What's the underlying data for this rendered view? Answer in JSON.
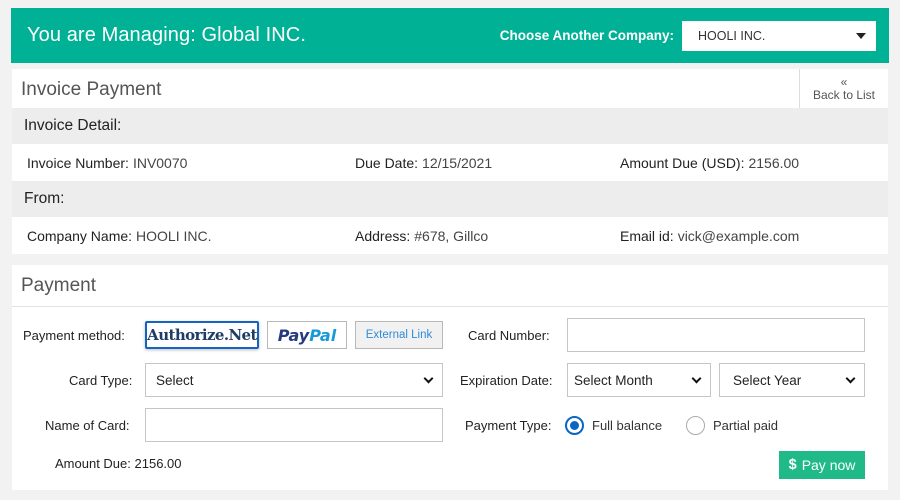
{
  "header": {
    "title": "You are Managing: Global INC.",
    "choose_label": "Choose Another Company:",
    "company_selected": "HOOLI INC."
  },
  "invoice": {
    "title": "Invoice Payment",
    "back_icon": "double-chevron-left-icon",
    "back_icon_glyph": "«",
    "back_label": "Back to List",
    "detail_heading": "Invoice Detail:",
    "invoice_number_label": "Invoice Number:",
    "invoice_number": "INV0070",
    "due_date_label": "Due Date:",
    "due_date": "12/15/2021",
    "amount_due_label": "Amount Due (USD):",
    "amount_due": "2156.00",
    "from_heading": "From:",
    "company_name_label": "Company Name:",
    "company_name": "HOOLI INC.",
    "address_label": "Address:",
    "address": "#678, Gillco",
    "email_label": "Email id:",
    "email": "vick@example.com"
  },
  "payment": {
    "title": "Payment",
    "method_label": "Payment method:",
    "methods": {
      "authorize": "Authorize.Net",
      "paypal_pay": "Pay",
      "paypal_pal": "Pal",
      "external": "External Link"
    },
    "card_number_label": "Card Number:",
    "card_number_value": "",
    "card_type_label": "Card Type:",
    "card_type_selected": "Select",
    "expiration_label": "Expiration Date:",
    "month_selected": "Select Month",
    "year_selected": "Select Year",
    "name_label": "Name of Card:",
    "name_value": "",
    "payment_type_label": "Payment Type:",
    "payment_types": [
      {
        "label": "Full balance",
        "selected": true
      },
      {
        "label": "Partial paid",
        "selected": false
      }
    ],
    "amount_due_label": "Amount Due:",
    "amount_due": "2156.00",
    "pay_icon": "dollar-icon",
    "pay_icon_glyph": "$",
    "pay_label": "Pay now"
  },
  "colors": {
    "brand": "#00b196",
    "pay_button": "#1fba87",
    "radio_selected": "#0a66c2",
    "authorize_border": "#1565c0",
    "external_link": "#2f8ad8"
  }
}
